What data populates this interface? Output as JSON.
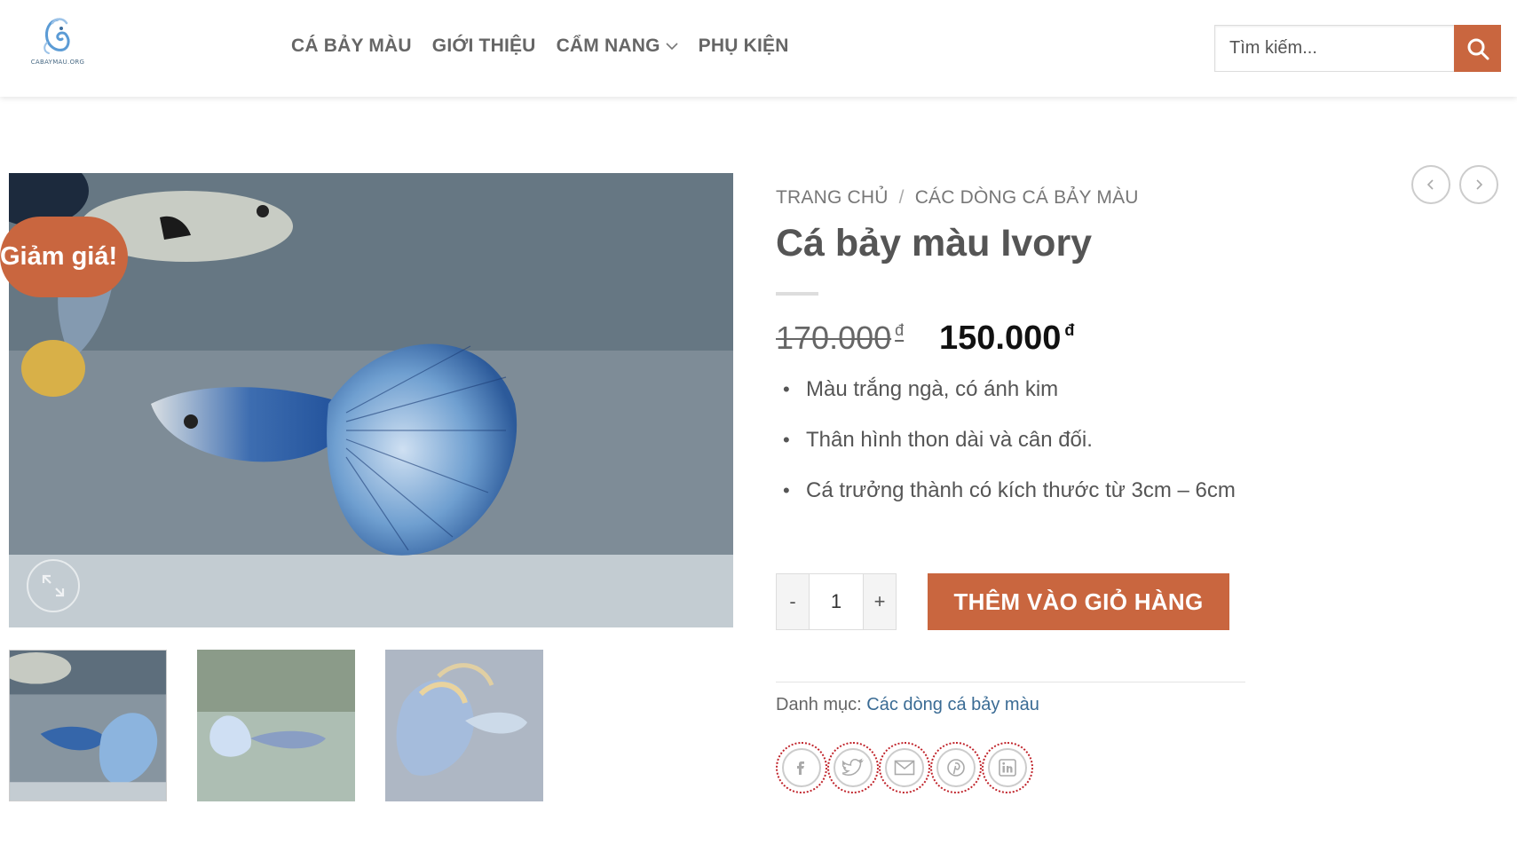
{
  "header": {
    "logo_text": "CABAYMAU.ORG",
    "nav": [
      {
        "label": "CÁ BẢY MÀU",
        "has_dropdown": false
      },
      {
        "label": "GIỚI THIỆU",
        "has_dropdown": false
      },
      {
        "label": "CẨM NANG",
        "has_dropdown": true
      },
      {
        "label": "PHỤ KIỆN",
        "has_dropdown": false
      }
    ],
    "search_placeholder": "Tìm kiếm...",
    "accent_color": "#c9663f"
  },
  "gallery": {
    "sale_badge": "Giảm giá!",
    "thumb_count": 3
  },
  "product": {
    "breadcrumb": [
      "TRANG CHỦ",
      "CÁC DÒNG CÁ BẢY MÀU"
    ],
    "breadcrumb_sep": "/",
    "title": "Cá bảy màu Ivory",
    "old_price": "170.000",
    "new_price": "150.000",
    "currency": "đ",
    "features": [
      "Màu trắng ngà, có ánh kim",
      "Thân hình thon dài và cân đối.",
      "Cá trưởng thành có kích thước từ 3cm – 6cm"
    ],
    "quantity": "1",
    "qty_minus": "-",
    "qty_plus": "+",
    "add_to_cart": "THÊM VÀO GIỎ HÀNG",
    "category_label": "Danh mục:",
    "category_value": "Các dòng cá bảy màu",
    "share_icons": [
      "facebook-icon",
      "twitter-icon",
      "email-icon",
      "pinterest-icon",
      "linkedin-icon"
    ]
  }
}
